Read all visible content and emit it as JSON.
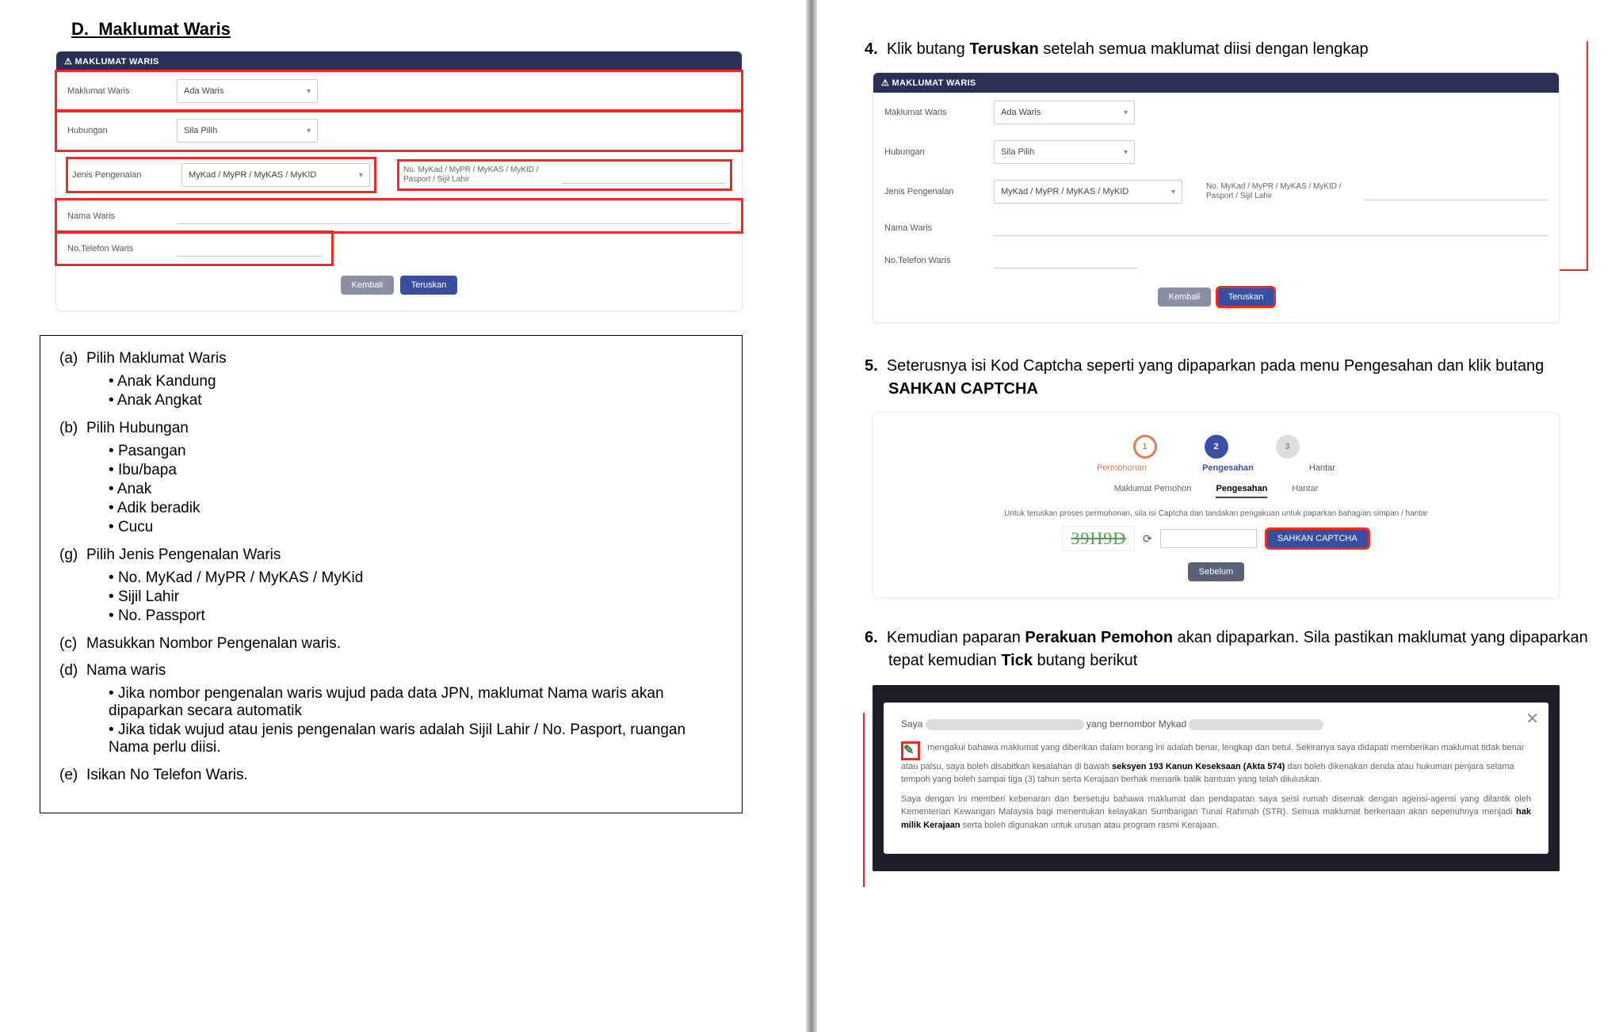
{
  "left": {
    "section_letter": "D.",
    "section_title": "Maklumat Waris",
    "form": {
      "header": "MAKLUMAT WARIS",
      "rows": {
        "maklumat_waris_label": "Maklumat Waris",
        "maklumat_waris_value": "Ada Waris",
        "hubungan_label": "Hubungan",
        "hubungan_value": "Sila Pilih",
        "jenis_label": "Jenis Pengenalan",
        "jenis_value": "MyKad / MyPR / MyKAS / MyKID",
        "idno_label": "No. MyKad / MyPR / MyKAS / MyKID / Pasport / Sijil Lahir",
        "nama_label": "Nama Waris",
        "tel_label": "No.Telefon Waris"
      },
      "btn_back": "Kembali",
      "btn_next": "Teruskan"
    },
    "instr": {
      "a": "Pilih Maklumat Waris",
      "a1": "Anak Kandung",
      "a2": "Anak Angkat",
      "b": "Pilih Hubungan",
      "b1": "Pasangan",
      "b2": "Ibu/bapa",
      "b3": "Anak",
      "b4": "Adik beradik",
      "b5": "Cucu",
      "g": "Pilih Jenis Pengenalan Waris",
      "g1": "No. MyKad / MyPR / MyKAS / MyKid",
      "g2": "Sijil Lahir",
      "g3": "No. Passport",
      "c": "Masukkan Nombor Pengenalan waris.",
      "d": "Nama waris",
      "d1": "Jika nombor pengenalan waris wujud pada data JPN, maklumat Nama waris akan dipaparkan secara automatik",
      "d2": " Jika tidak wujud atau jenis pengenalan waris adalah Sijil Lahir / No. Pasport, ruangan Nama perlu diisi.",
      "e": "Isikan No Telefon Waris."
    }
  },
  "right": {
    "step4_pre": "Klik butang ",
    "step4_b": "Teruskan",
    "step4_post": " setelah semua maklumat diisi dengan lengkap",
    "form": {
      "header": "MAKLUMAT WARIS",
      "maklumat_waris_label": "Maklumat Waris",
      "maklumat_waris_value": "Ada Waris",
      "hubungan_label": "Hubungan",
      "hubungan_value": "Sila Pilih",
      "jenis_label": "Jenis Pengenalan",
      "jenis_value": "MyKad / MyPR / MyKAS / MyKID",
      "idno_label": "No. MyKad / MyPR / MyKAS / MyKID / Pasport / Sijil Lahir",
      "nama_label": "Nama Waris",
      "tel_label": "No.Telefon Waris",
      "btn_back": "Kembali",
      "btn_next": "Teruskan"
    },
    "step5_pre": "Seterusnya isi Kod Captcha seperti yang dipaparkan pada menu Pengesahan dan klik butang ",
    "step5_b": "SAHKAN CAPTCHA",
    "stepper": {
      "s1": "Permohonan",
      "s2": "Pengesahan",
      "s3": "Hantar",
      "tab1": "Maklumat Pemohon",
      "tab2": "Pengesahan",
      "tab3": "Hantar",
      "note": "Untuk teruskan proses permohonan, sila isi Captcha dan tandakan pengakuan untuk paparkan bahagian simpan / hantar",
      "captcha_text": "39H9D",
      "btn_sahkan": "SAHKAN CAPTCHA",
      "btn_seb": "Sebelum"
    },
    "step6_pre": "Kemudian paparan ",
    "step6_b1": "Perakuan Pemohon",
    "step6_mid": " akan dipaparkan. Sila pastikan maklumat yang dipaparkan tepat kemudian ",
    "step6_b2": "Tick",
    "step6_post": " butang berikut",
    "decl": {
      "saya": "Saya",
      "yang": "yang bernombor Mykad",
      "p1a": "mengakui bahawa maklumat yang diberikan dalam borang ini adalah benar, lengkap dan betul. Sekiranya saya didapati memberikan maklumat tidak benar atau palsu, saya boleh disabitkan kesalahan di bawah ",
      "p1b": "seksyen 193 Kanun Keseksaan (Akta 574)",
      "p1c": " dan boleh dikenakan denda atau hukuman penjara selama tempoh yang boleh sampai tiga (3) tahun serta Kerajaan berhak menarik balik bantuan yang telah diluluskan.",
      "p2a": "Saya dengan ini memberi kebenaran dan bersetuju bahawa maklumat dan pendapatan saya seisi rumah disemak dengan agensi-agensi yang dilantik oleh Kementerian Kewangan Malaysia bagi menentukan kelayakan Sumbangan Tunai Rahmah (STR). Semua maklumat berkenaan akan sepenuhnya menjadi ",
      "p2b": "hak milik Kerajaan",
      "p2c": " serta boleh digunakan untuk urusan atau program rasmi Kerajaan."
    }
  }
}
